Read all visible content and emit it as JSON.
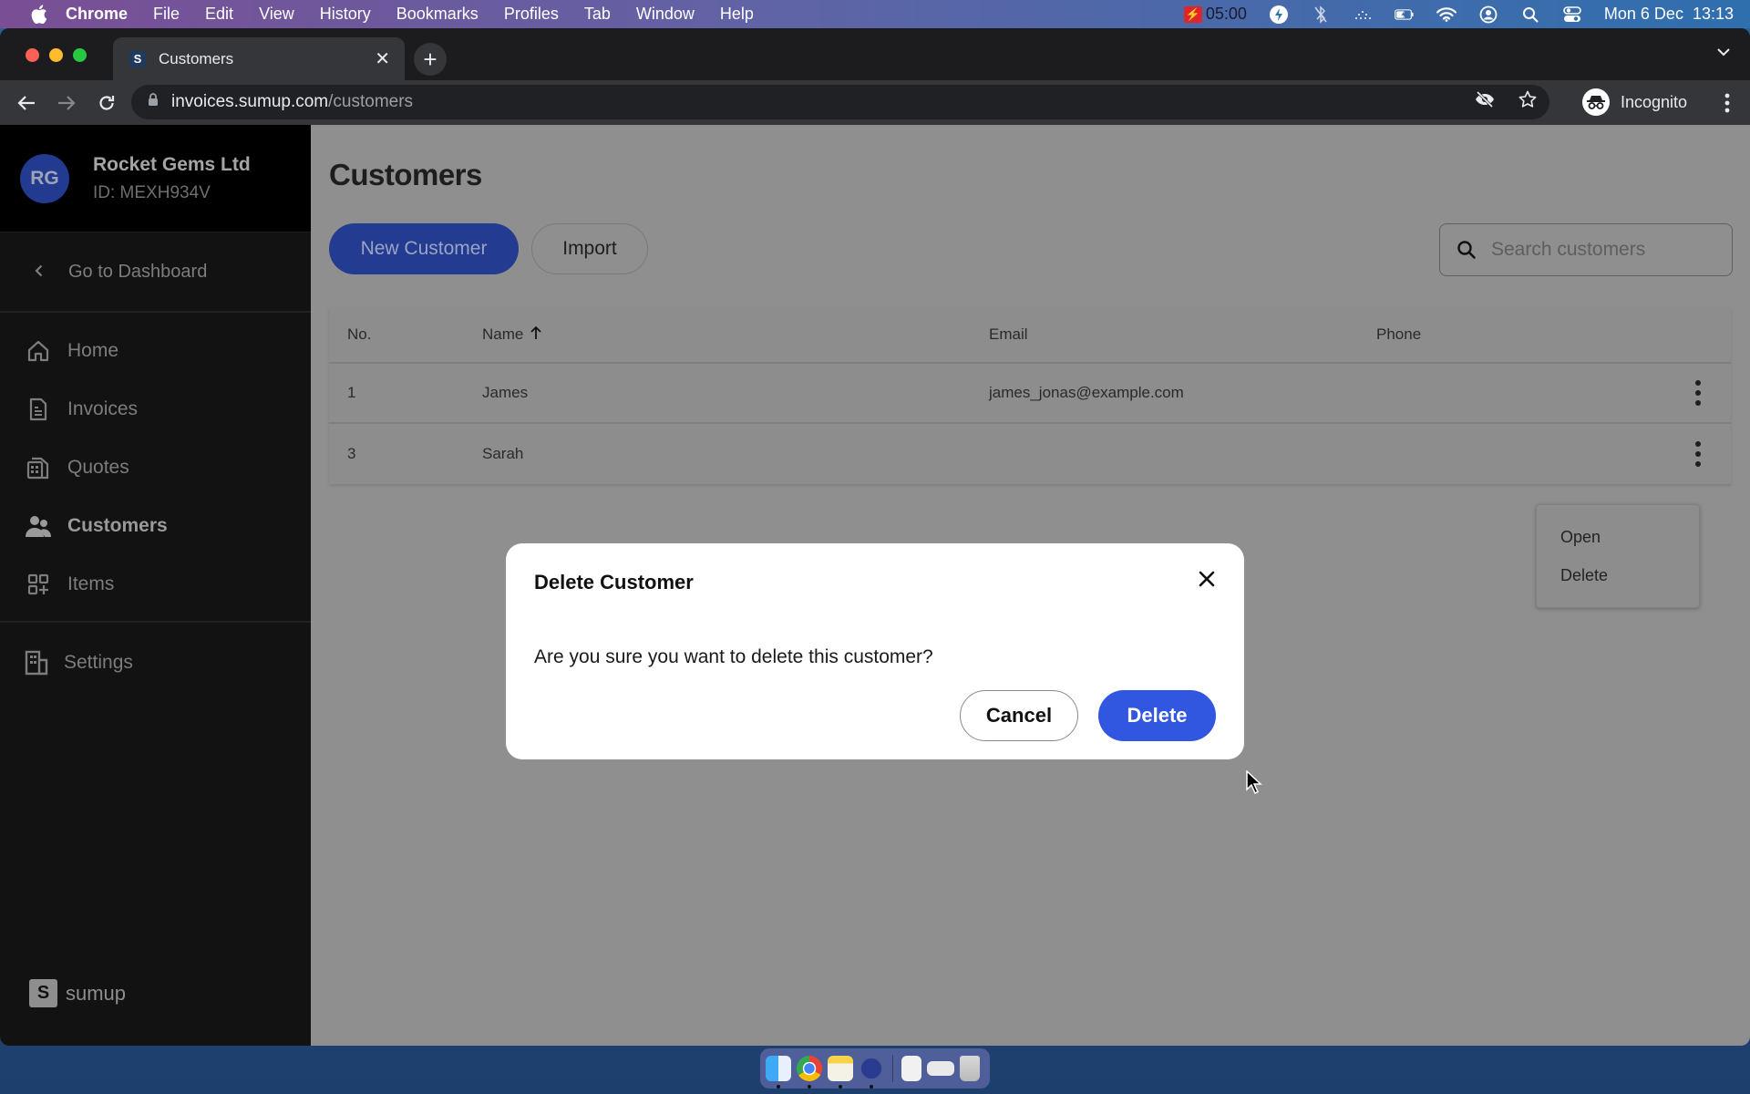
{
  "menubar": {
    "apple_icon": "apple-logo-icon",
    "app_name": "Chrome",
    "items": [
      "File",
      "Edit",
      "View",
      "History",
      "Bookmarks",
      "Profiles",
      "Tab",
      "Window",
      "Help"
    ],
    "recording_time": "05:00",
    "datetime": "Mon 6 Dec  13:13",
    "status_icons": [
      "bolt-icon",
      "bluetooth-off-icon",
      "network-activity-icon",
      "battery-charging-icon",
      "wifi-icon",
      "user-account-icon",
      "spotlight-search-icon",
      "control-center-icon"
    ]
  },
  "browser": {
    "tab": {
      "title": "Customers",
      "favicon": "sumup-favicon"
    },
    "url_host": "invoices.sumup.com",
    "url_path": "/customers",
    "profile_label": "Incognito"
  },
  "sidebar": {
    "avatar_initials": "RG",
    "org_name": "Rocket Gems Ltd",
    "org_id": "ID: MEXH934V",
    "back_link": "Go to Dashboard",
    "items": [
      {
        "label": "Home",
        "icon": "home-icon"
      },
      {
        "label": "Invoices",
        "icon": "invoice-icon"
      },
      {
        "label": "Quotes",
        "icon": "quotes-icon"
      },
      {
        "label": "Customers",
        "icon": "customers-icon",
        "active": true
      },
      {
        "label": "Items",
        "icon": "items-grid-icon"
      }
    ],
    "settings_label": "Settings",
    "brand": "sumup"
  },
  "main": {
    "title": "Customers",
    "new_customer_label": "New Customer",
    "import_label": "Import",
    "search_placeholder": "Search customers",
    "search_value": "",
    "table": {
      "columns": [
        "No.",
        "Name",
        "Email",
        "Phone"
      ],
      "sort_indicator": "↑",
      "rows": [
        {
          "no": "1",
          "name": "James",
          "email": "james_jonas@example.com",
          "phone": ""
        },
        {
          "no": "3",
          "name": "Sarah",
          "email": "",
          "phone": ""
        }
      ]
    },
    "row_menu": {
      "items": [
        "Open",
        "Delete"
      ]
    }
  },
  "modal": {
    "title": "Delete Customer",
    "message": "Are you sure you want to delete this customer?",
    "cancel_label": "Cancel",
    "delete_label": "Delete"
  },
  "colors": {
    "primary": "#3156e0",
    "overlay_dimmed_primary": "#233b91",
    "sidebar_bg": "#121212"
  },
  "dock": {
    "apps": [
      "Finder",
      "Google Chrome",
      "Notes",
      "Reeder",
      "Document",
      "Screenshot",
      "Trash"
    ]
  }
}
